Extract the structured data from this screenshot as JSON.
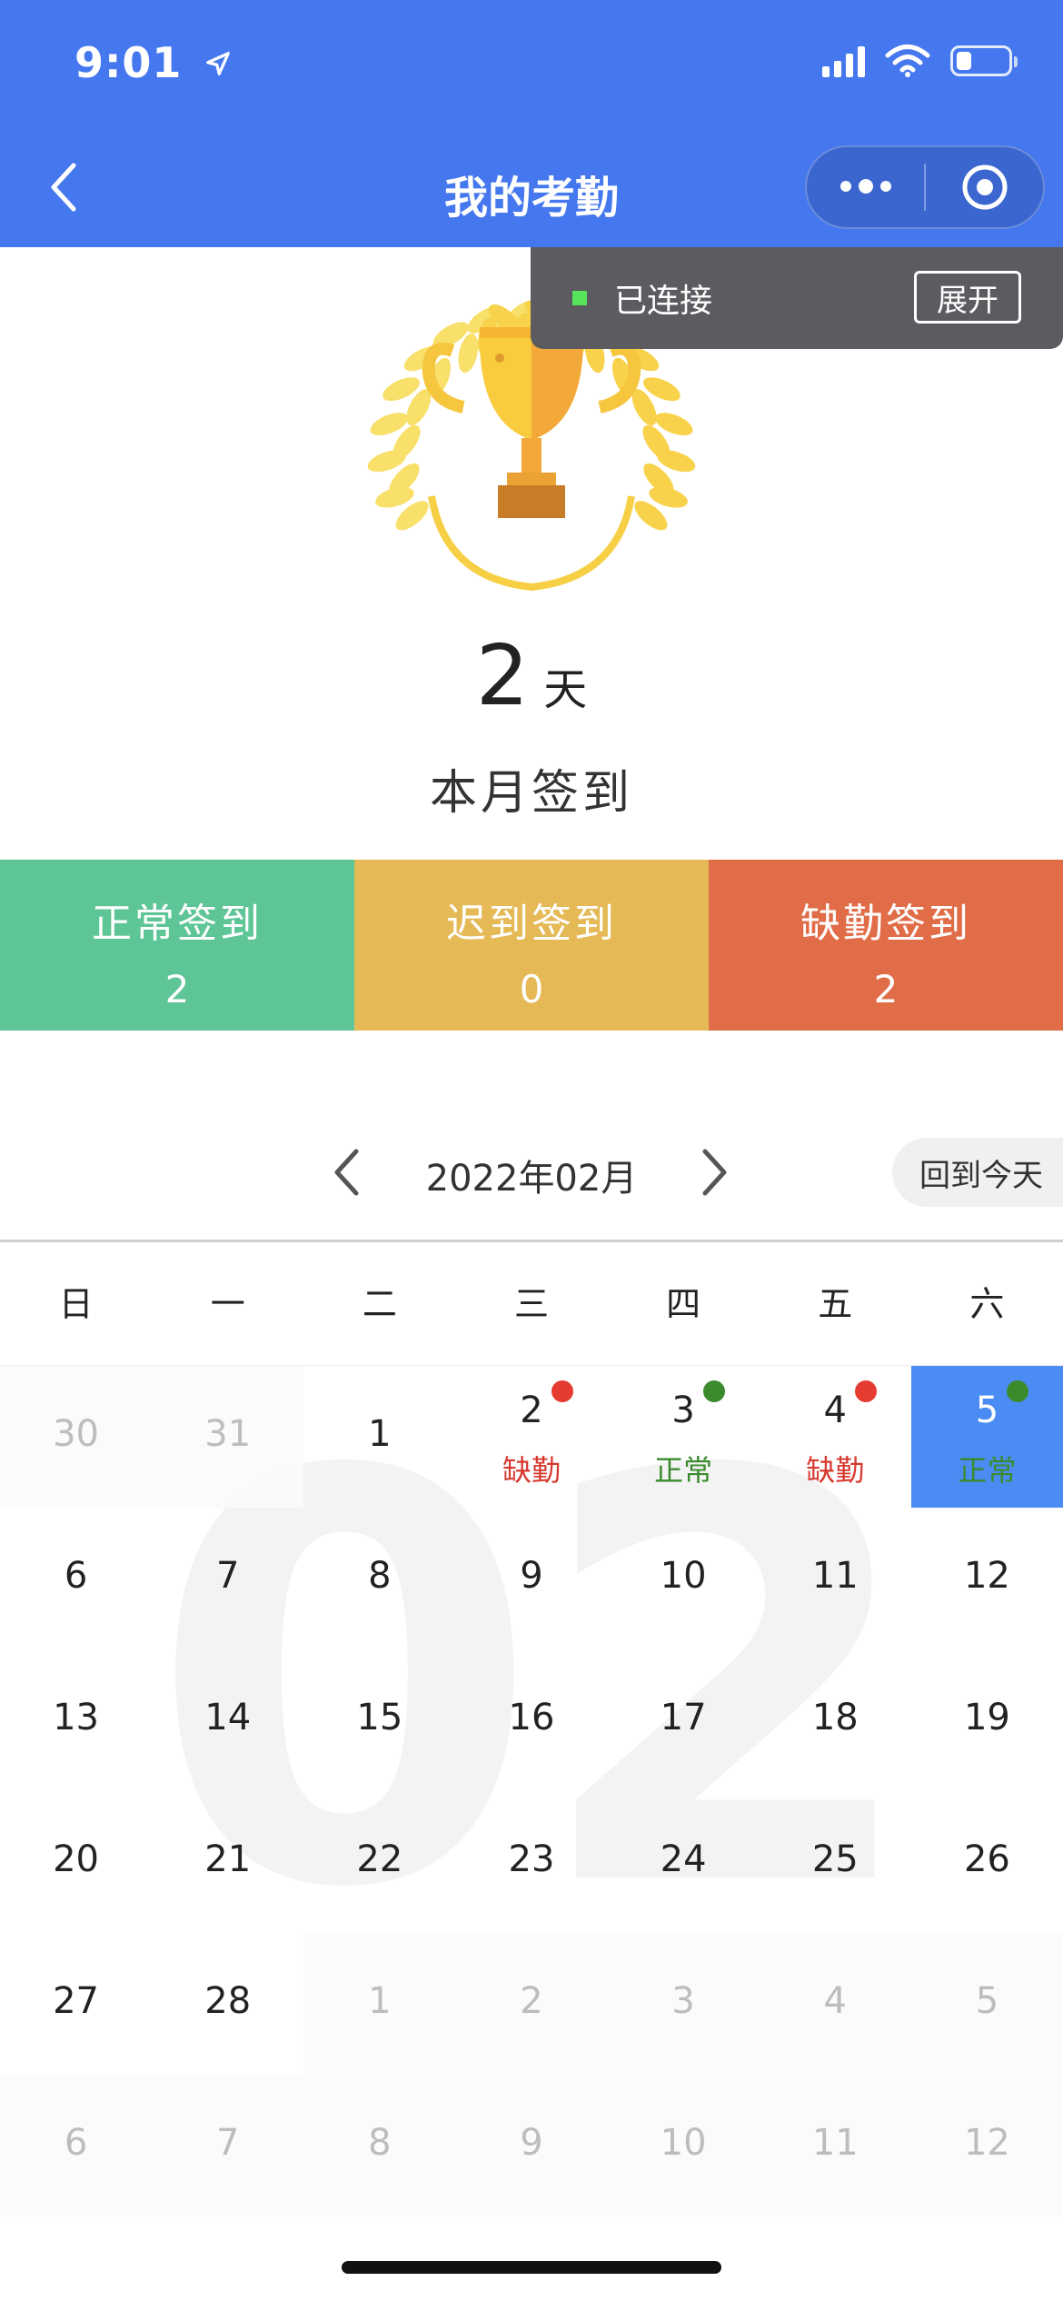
{
  "status_bar": {
    "time": "9:01",
    "battery_level": 0.3
  },
  "nav": {
    "title": "我的考勤"
  },
  "toast": {
    "status": "已连接",
    "expand_label": "展开",
    "indicator_color": "#55e45a"
  },
  "summary": {
    "count": "2",
    "unit": "天",
    "label": "本月签到"
  },
  "stats": [
    {
      "label": "正常签到",
      "value": "2",
      "color": "#5ec596"
    },
    {
      "label": "迟到签到",
      "value": "0",
      "color": "#e5b955"
    },
    {
      "label": "缺勤签到",
      "value": "2",
      "color": "#e06d48"
    }
  ],
  "calendar": {
    "month_title": "2022年02月",
    "today_label": "回到今天",
    "watermark": "02",
    "weekdays": [
      "日",
      "一",
      "二",
      "三",
      "四",
      "五",
      "六"
    ],
    "status_colors": {
      "正常": "#3b8b2d",
      "缺勤": "#d63a2f"
    },
    "dot_colors": {
      "正常": "#3b8b2d",
      "缺勤": "#e53b30"
    },
    "selected_color": "#4a8cf3",
    "cells": [
      {
        "day": "30",
        "other": true
      },
      {
        "day": "31",
        "other": true
      },
      {
        "day": "1"
      },
      {
        "day": "2",
        "status": "缺勤"
      },
      {
        "day": "3",
        "status": "正常"
      },
      {
        "day": "4",
        "status": "缺勤"
      },
      {
        "day": "5",
        "status": "正常",
        "selected": true
      },
      {
        "day": "6"
      },
      {
        "day": "7"
      },
      {
        "day": "8"
      },
      {
        "day": "9"
      },
      {
        "day": "10"
      },
      {
        "day": "11"
      },
      {
        "day": "12"
      },
      {
        "day": "13"
      },
      {
        "day": "14"
      },
      {
        "day": "15"
      },
      {
        "day": "16"
      },
      {
        "day": "17"
      },
      {
        "day": "18"
      },
      {
        "day": "19"
      },
      {
        "day": "20"
      },
      {
        "day": "21"
      },
      {
        "day": "22"
      },
      {
        "day": "23"
      },
      {
        "day": "24"
      },
      {
        "day": "25"
      },
      {
        "day": "26"
      },
      {
        "day": "27"
      },
      {
        "day": "28"
      },
      {
        "day": "1",
        "other": true
      },
      {
        "day": "2",
        "other": true
      },
      {
        "day": "3",
        "other": true
      },
      {
        "day": "4",
        "other": true
      },
      {
        "day": "5",
        "other": true
      },
      {
        "day": "6",
        "other": true
      },
      {
        "day": "7",
        "other": true
      },
      {
        "day": "8",
        "other": true
      },
      {
        "day": "9",
        "other": true
      },
      {
        "day": "10",
        "other": true
      },
      {
        "day": "11",
        "other": true
      },
      {
        "day": "12",
        "other": true
      }
    ]
  }
}
